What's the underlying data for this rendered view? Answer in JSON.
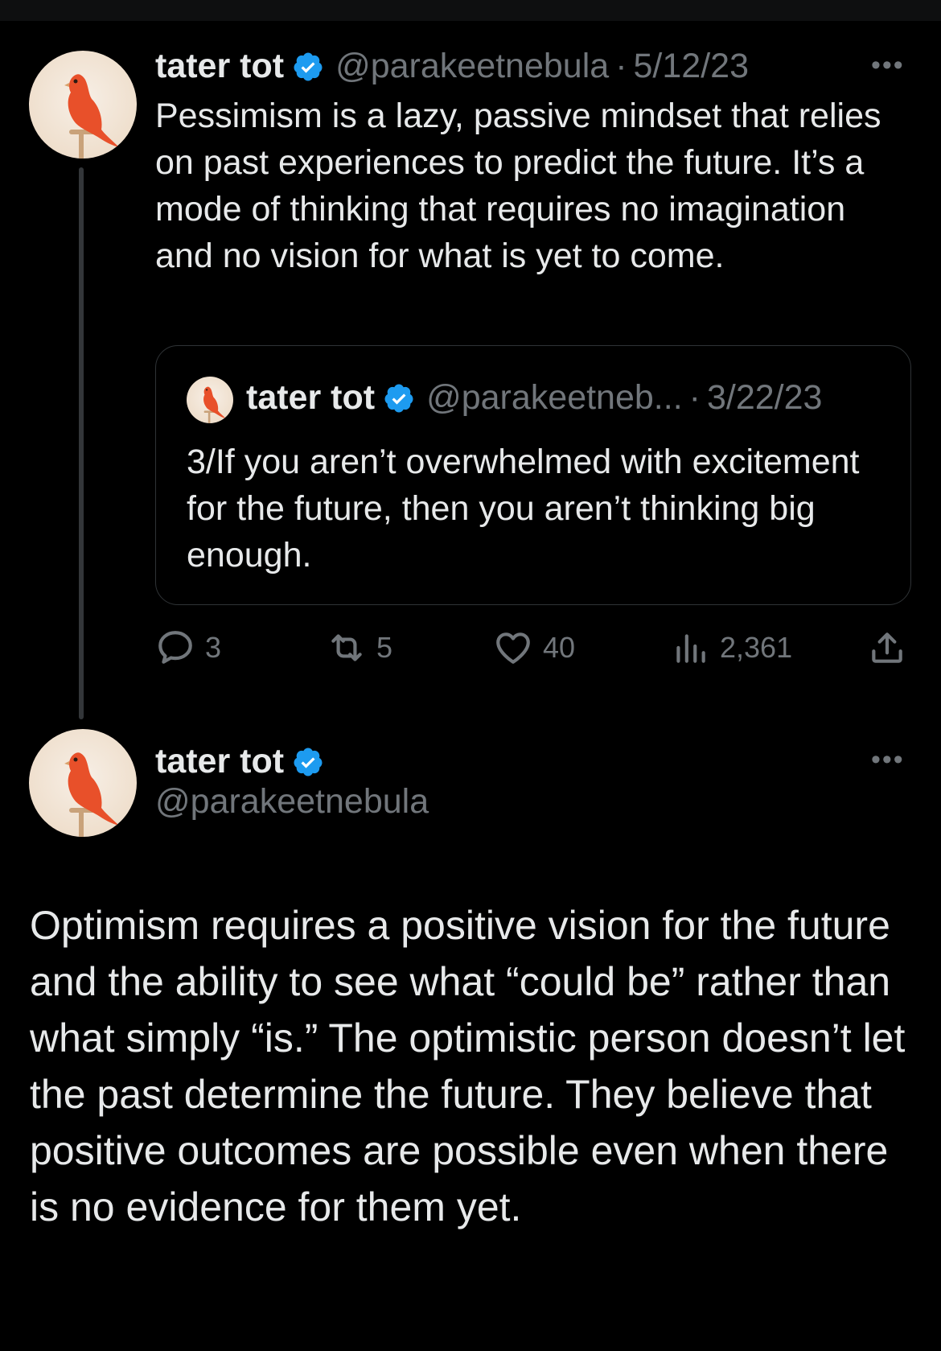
{
  "tweets": [
    {
      "author_name": "tater tot",
      "handle": "@parakeetnebula",
      "separator": "·",
      "date": "5/12/23",
      "more_label": "•••",
      "text": "Pessimism is a lazy, passive mindset that relies on past experiences to predict the future. It’s a mode of thinking that requires no imagination and no vision for what is yet to come.",
      "quote": {
        "author_name": "tater tot",
        "handle": "@parakeetneb...",
        "separator": "·",
        "date": "3/22/23",
        "text": "3/If you aren’t overwhelmed with excitement for the future, then you aren’t thinking big enough."
      },
      "actions": {
        "replies": "3",
        "retweets": "5",
        "likes": "40",
        "views": "2,361"
      }
    },
    {
      "author_name": "tater tot",
      "handle": "@parakeetnebula",
      "more_label": "•••",
      "text": "Optimism requires a positive vision for the future and the ability to see what “could be” rather than what simply “is.” The optimistic person doesn’t let the past determine the future. They believe that positive outcomes are possible even when there is no evidence for them yet."
    }
  ],
  "icons": {
    "verified": "verified-badge-icon",
    "reply": "reply-icon",
    "retweet": "retweet-icon",
    "like": "heart-icon",
    "views": "views-icon",
    "share": "share-icon"
  },
  "colors": {
    "background": "#000000",
    "text": "#e7e9ea",
    "muted": "#71767b",
    "verified": "#1d9bf0",
    "bird": "#e8502a"
  }
}
